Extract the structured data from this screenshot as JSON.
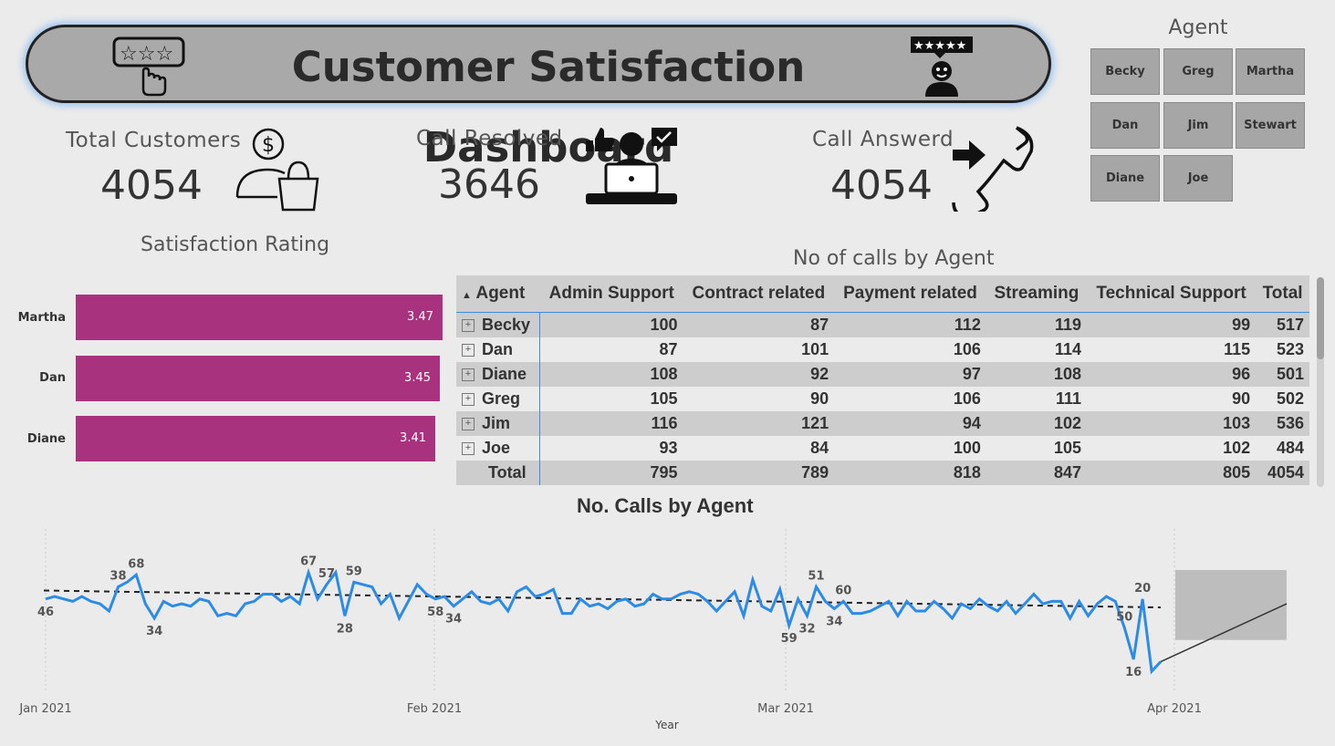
{
  "header": {
    "title": "Customer Satisfaction Dashboard"
  },
  "kpis": {
    "total_customers": {
      "label": "Total Customers",
      "value": "4054"
    },
    "call_resolved": {
      "label": "Call Resolved",
      "value": "3646"
    },
    "call_answered": {
      "label": "Call Answerd",
      "value": "4054"
    }
  },
  "slicer": {
    "title": "Agent",
    "options": [
      "Becky",
      "Greg",
      "Martha",
      "Dan",
      "Jim",
      "Stewart",
      "Diane",
      "Joe"
    ]
  },
  "satisfaction": {
    "title": "Satisfaction Rating",
    "bars": [
      {
        "name": "Martha",
        "value": "3.47"
      },
      {
        "name": "Dan",
        "value": "3.45"
      },
      {
        "name": "Diane",
        "value": "3.41"
      }
    ],
    "bar_color": "#a8327d"
  },
  "matrix": {
    "title": "No of calls by Agent",
    "columns": [
      "Agent",
      "Admin Support",
      "Contract related",
      "Payment related",
      "Streaming",
      "Technical Support",
      "Total"
    ],
    "rows": [
      [
        "Becky",
        "100",
        "87",
        "112",
        "119",
        "99",
        "517"
      ],
      [
        "Dan",
        "87",
        "101",
        "106",
        "114",
        "115",
        "523"
      ],
      [
        "Diane",
        "108",
        "92",
        "97",
        "108",
        "96",
        "501"
      ],
      [
        "Greg",
        "105",
        "90",
        "106",
        "111",
        "90",
        "502"
      ],
      [
        "Jim",
        "116",
        "121",
        "94",
        "102",
        "103",
        "536"
      ],
      [
        "Joe",
        "93",
        "84",
        "100",
        "105",
        "102",
        "484"
      ]
    ],
    "total": [
      "Total",
      "795",
      "789",
      "818",
      "847",
      "805",
      "4054"
    ]
  },
  "chart_data": {
    "type": "line",
    "title": "No. Calls by Agent",
    "xlabel": "Year",
    "ylabel": "",
    "x_ticks": [
      "Jan 2021",
      "Feb 2021",
      "Mar 2021",
      "Apr 2021"
    ],
    "ylim": [
      10,
      72
    ],
    "line_color": "#2b8be6",
    "values": [
      46,
      47,
      46,
      45,
      47,
      45,
      44,
      41,
      51,
      53,
      56,
      44,
      38,
      45,
      43,
      44,
      43,
      46,
      45,
      39,
      40,
      39,
      44,
      45,
      48,
      48,
      45,
      47,
      44,
      57,
      46,
      52,
      57,
      39,
      53,
      52,
      51,
      44,
      48,
      38,
      45,
      52,
      48,
      46,
      47,
      43,
      46,
      49,
      45,
      44,
      46,
      41,
      49,
      51,
      47,
      48,
      50,
      40,
      40,
      46,
      43,
      44,
      42,
      45,
      46,
      43,
      44,
      48,
      46,
      46,
      48,
      49,
      48,
      45,
      41,
      45,
      49,
      39,
      54,
      43,
      41,
      50,
      35,
      46,
      39,
      51,
      45,
      42,
      45,
      40,
      40,
      41,
      43,
      45,
      39,
      45,
      41,
      41,
      45,
      42,
      38,
      44,
      42,
      46,
      43,
      41,
      45,
      40,
      44,
      48,
      44,
      45,
      45,
      38,
      45,
      39,
      44,
      47,
      45,
      34,
      21,
      46,
      16,
      20
    ],
    "point_labels": [
      {
        "index": 0,
        "label": "46"
      },
      {
        "index": 8,
        "label": "38"
      },
      {
        "index": 10,
        "label": "68"
      },
      {
        "index": 12,
        "label": "34"
      },
      {
        "index": 29,
        "label": "67"
      },
      {
        "index": 31,
        "label": "57"
      },
      {
        "index": 33,
        "label": "28"
      },
      {
        "index": 34,
        "label": "59"
      },
      {
        "index": 43,
        "label": "58"
      },
      {
        "index": 45,
        "label": "34"
      },
      {
        "index": 82,
        "label": "59"
      },
      {
        "index": 84,
        "label": "32"
      },
      {
        "index": 85,
        "label": "51"
      },
      {
        "index": 87,
        "label": "34"
      },
      {
        "index": 88,
        "label": "60"
      },
      {
        "index": 119,
        "label": "50"
      },
      {
        "index": 120,
        "label": "16"
      },
      {
        "index": 121,
        "label": "20"
      }
    ],
    "trend": {
      "start": 49.5,
      "end": 42.5
    },
    "forecast": {
      "value": 44,
      "band_low": 29,
      "band_high": 58
    }
  }
}
